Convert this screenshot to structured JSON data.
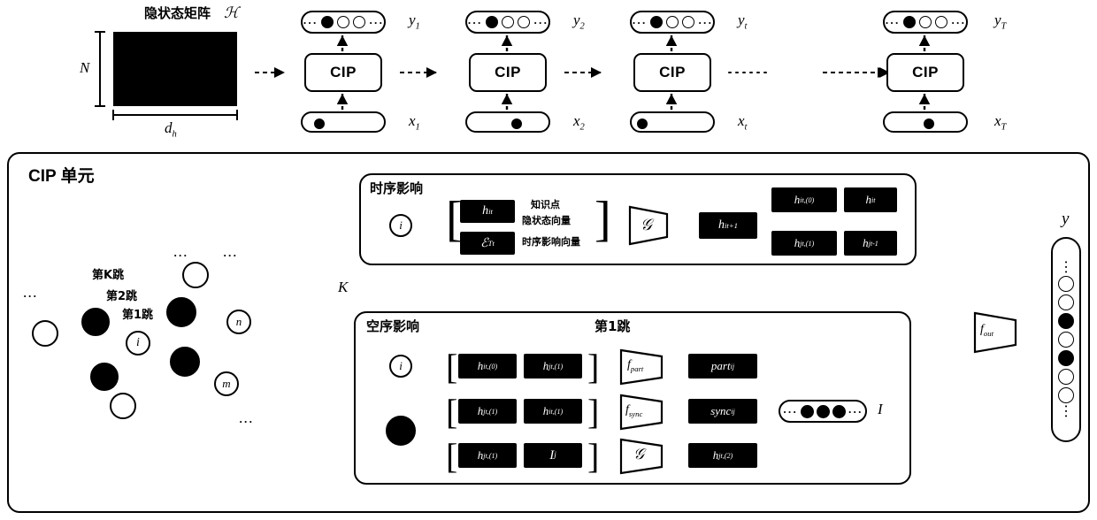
{
  "figure": {
    "type": "architecture-diagram",
    "topic": "CIP recurrent knowledge-tracing cell"
  },
  "top": {
    "matrix": {
      "title_cn": "隐状态矩阵",
      "title_sym": "ℋ",
      "row_label": "N",
      "col_label": "d",
      "col_label_sub": "h"
    },
    "columns": [
      {
        "cip_label": "CIP",
        "y_label": "y",
        "y_sub": "1",
        "x_label": "x",
        "x_sub": "1",
        "x_marker_pos": 0.18,
        "y_cells": [
          "dots",
          "fill",
          "open",
          "open",
          "dots"
        ]
      },
      {
        "cip_label": "CIP",
        "y_label": "y",
        "y_sub": "2",
        "x_label": "x",
        "x_sub": "2",
        "x_marker_pos": 0.55,
        "y_cells": [
          "dots",
          "fill",
          "open",
          "open",
          "dots"
        ]
      },
      {
        "cip_label": "CIP",
        "y_label": "y",
        "y_sub": "t",
        "x_label": "x",
        "x_sub": "t",
        "x_marker_pos": 0.08,
        "y_cells": [
          "dots",
          "fill",
          "open",
          "open",
          "dots"
        ]
      },
      {
        "cip_label": "CIP",
        "y_label": "y",
        "y_sub": "T",
        "x_label": "x",
        "x_sub": "T",
        "x_marker_pos": 0.5,
        "y_cells": [
          "dots",
          "fill",
          "open",
          "open",
          "dots"
        ]
      }
    ],
    "between_columns": [
      "dashed-arrow",
      "dashed-arrow",
      "dotted-ellipsis",
      "dashed-arrow"
    ]
  },
  "cell": {
    "title": "CIP 单元",
    "graph": {
      "hop_labels": [
        "第K跳",
        "第2跳",
        "第1跳"
      ],
      "center_node": "i",
      "outer_nodes": [
        "n",
        "m"
      ],
      "ellipsis": [
        "...",
        "...",
        "...",
        "..."
      ]
    },
    "repeat_label": "K",
    "temporal": {
      "title": "时序影响",
      "input_node": "i",
      "stack": [
        {
          "tex": "h",
          "sub": "i",
          "sup": "t"
        },
        {
          "tex": "ℰ",
          "sub": "T",
          "sup": "t"
        }
      ],
      "annotations": [
        "知识点",
        "隐状态向量",
        "时序影响向量"
      ],
      "func": "𝒢",
      "output": {
        "tex": "h",
        "sub": "i",
        "sup": "t+1"
      }
    },
    "assign": [
      {
        "dst_tex": "h",
        "dst_sub": "i",
        "dst_sup": "t,(0)",
        "src_tex": "h",
        "src_sub": "i",
        "src_sup": "t"
      },
      {
        "dst_tex": "h",
        "dst_sub": "j",
        "dst_sup": "t,(1)",
        "src_tex": "h",
        "src_sub": "j",
        "src_sup": "t-1"
      }
    ],
    "spatial": {
      "title": "空序影响",
      "hop_title": "第1跳",
      "input_node": "i",
      "rows": [
        {
          "pair": [
            {
              "tex": "h",
              "sub": "i",
              "sup": "t,(0)"
            },
            {
              "tex": "h",
              "sub": "j",
              "sup": "t,(1)"
            }
          ],
          "func": "f",
          "func_sub": "part",
          "out_tex": "part",
          "out_sub": "ij"
        },
        {
          "pair": [
            {
              "tex": "h",
              "sub": "j",
              "sup": "t,(1)"
            },
            {
              "tex": "h",
              "sub": "i",
              "sup": "t,(1)"
            }
          ],
          "func": "f",
          "func_sub": "sync",
          "out_tex": "sync",
          "out_sub": "ij"
        },
        {
          "pair": [
            {
              "tex": "h",
              "sub": "j",
              "sup": "t,(1)"
            },
            {
              "tex": "I",
              "sub": "j",
              "sup": ""
            }
          ],
          "func": "𝒢",
          "func_sub": "",
          "out_tex": "h",
          "out_sub": "j",
          "out_sup": "t,(2)"
        }
      ],
      "aggregate": {
        "label": "I",
        "cells": [
          "dots",
          "fill",
          "fill",
          "fill",
          "dots"
        ]
      }
    },
    "output": {
      "func": "f",
      "func_sub": "out",
      "label": "y",
      "cells": [
        "dots",
        "open",
        "open",
        "fill",
        "open",
        "fill",
        "open",
        "open",
        "dots"
      ]
    }
  }
}
